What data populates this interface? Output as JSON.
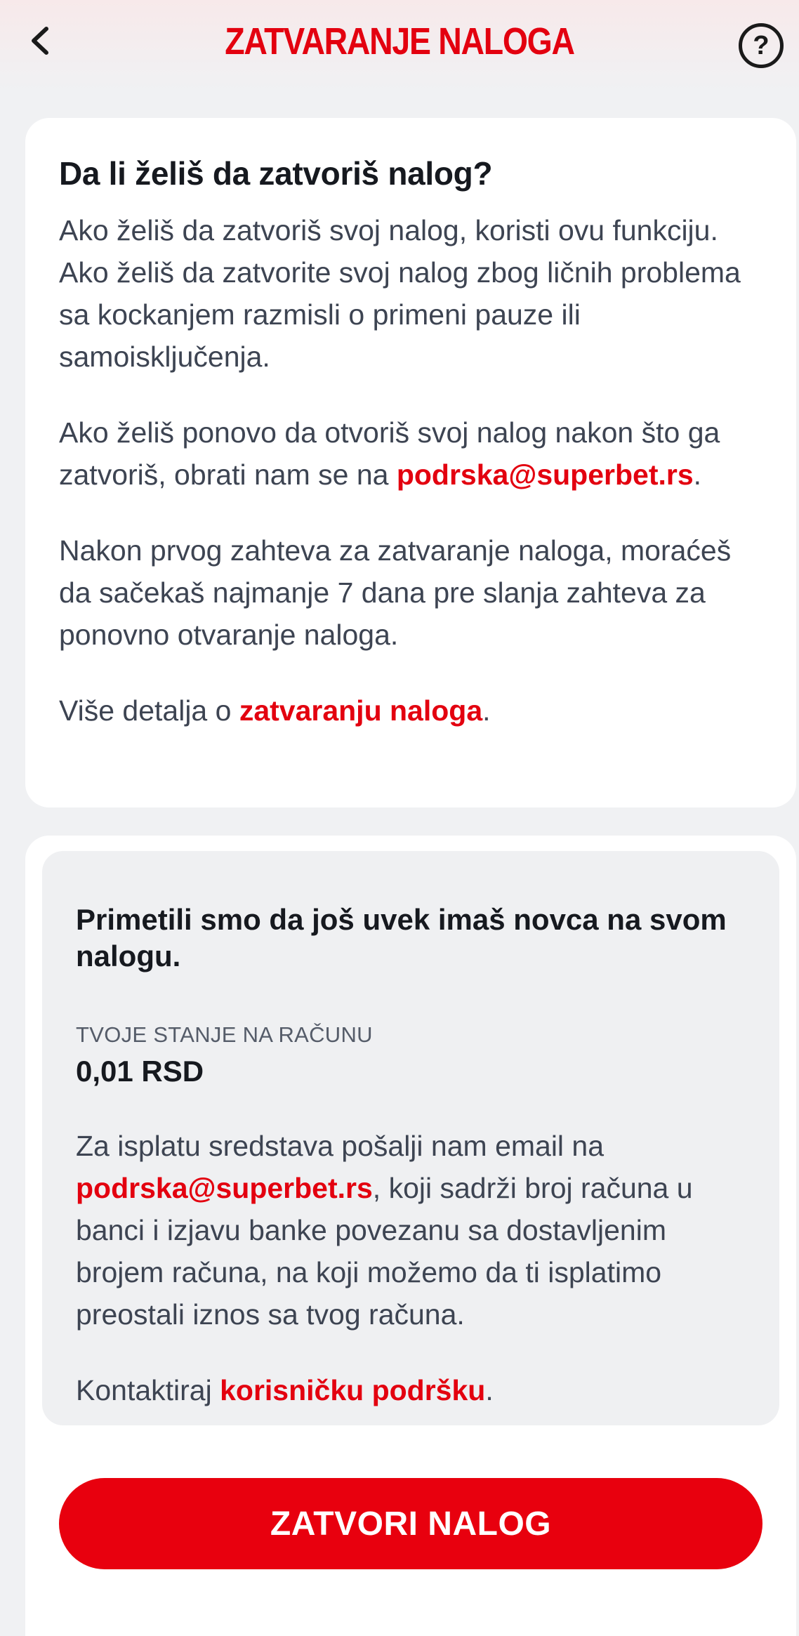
{
  "header": {
    "title": "ZATVARANJE NALOGA",
    "back_icon": "chevron-left-icon",
    "help_icon": "question-circle-icon",
    "help_glyph": "?"
  },
  "info_card": {
    "heading": "Da li želiš da zatvoriš nalog?",
    "p1": "Ako želiš da zatvoriš svoj nalog, koristi ovu funkciju. Ako želiš da zatvorite svoj nalog zbog ličnih problema sa kockanjem razmisli o primeni pauze ili samoisključenja.",
    "p2_before": "Ako želiš ponovo da otvoriš svoj nalog nakon što ga zatvoriš, obrati nam se na ",
    "p2_email": "podrska@superbet.rs",
    "p2_after": ".",
    "p3": "Nakon prvog zahteva za zatvaranje naloga, moraćeš da sačekaš najmanje 7 dana pre slanja zahteva za ponovno otvaranje naloga.",
    "p4_before": "Više detalja o ",
    "p4_link": "zatvaranju naloga",
    "p4_after": "."
  },
  "balance_card": {
    "heading": "Primetili smo da još uvek imaš novca na svom nalogu.",
    "balance_label": "TVOJE STANJE NA RAČUNU",
    "balance_value": "0,01 RSD",
    "p1_before": "Za isplatu sredstava pošalji nam email na ",
    "p1_email": "podrska@superbet.rs",
    "p1_after": ", koji sadrži broj računa u banci i izjavu banke povezanu sa dostavljenim brojem računa, na koji možemo da ti isplatimo preostali iznos sa tvog računa.",
    "p2_before": "Kontaktiraj ",
    "p2_link": "korisničku podršku",
    "p2_after": "."
  },
  "actions": {
    "close_account_label": "ZATVORI NALOG"
  },
  "colors": {
    "accent": "#e3000f",
    "text": "#3d4452",
    "heading": "#16191f",
    "background": "#f0f1f3"
  }
}
